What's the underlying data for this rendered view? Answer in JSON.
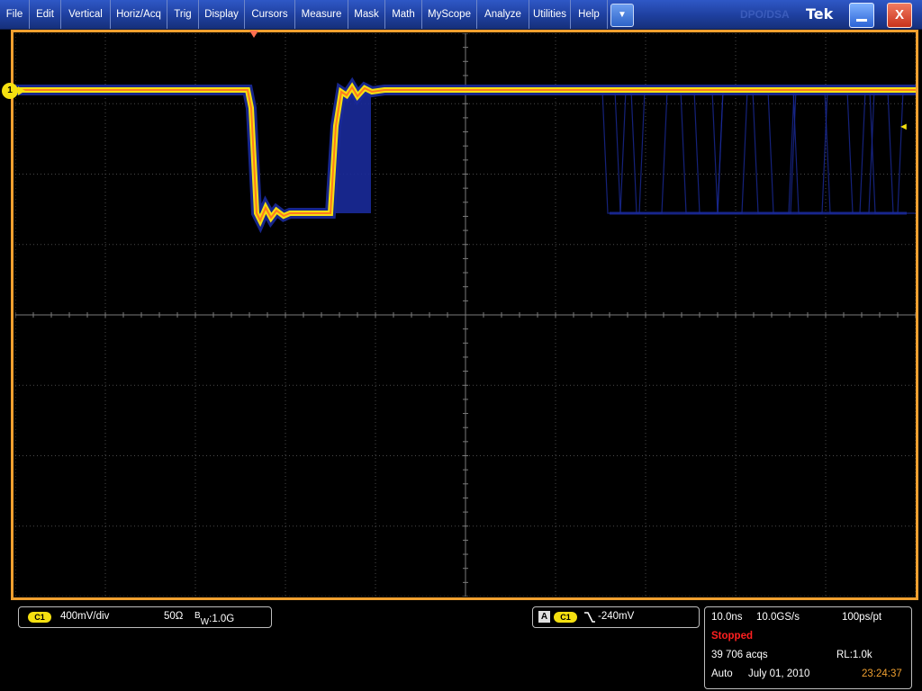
{
  "menubar": {
    "items": [
      "File",
      "Edit",
      "Vertical",
      "Horiz/Acq",
      "Trig",
      "Display",
      "Cursors",
      "Measure",
      "Mask",
      "Math",
      "MyScope",
      "Analyze",
      "Utilities",
      "Help"
    ],
    "dropdown_glyph": "▼",
    "brand": "Tek",
    "ghost_label": "DPO/DSA"
  },
  "window_controls": {
    "minimize_icon": "minimize-icon",
    "close_label": "X"
  },
  "display": {
    "ch1_marker_label": "1",
    "colors": {
      "frame": "#f0a030",
      "trace_core": "#ff7a20",
      "trace_warm": "#f5e010",
      "trace_persist": "#1a2a9a"
    }
  },
  "channel_readout": {
    "badge": "C1",
    "scale": "400mV/div",
    "termination": "50Ω",
    "bw_prefix": "B",
    "bw_sub": "W",
    "bw_value": ":1.0G"
  },
  "trigger_readout": {
    "source_label": "A",
    "badge": "C1",
    "slope_icon": "falling-edge-icon",
    "level": "-240mV"
  },
  "acquisition_readout": {
    "time_per_div": "10.0ns",
    "sample_rate": "10.0GS/s",
    "resolution": "100ps/pt",
    "status": "Stopped",
    "acqs": "39 706 acqs",
    "record_length": "RL:1.0k",
    "mode": "Auto",
    "date": "July 01, 2010",
    "time": "23:24:37",
    "status_color": "#ff2020",
    "time_color": "#f0a030"
  }
}
